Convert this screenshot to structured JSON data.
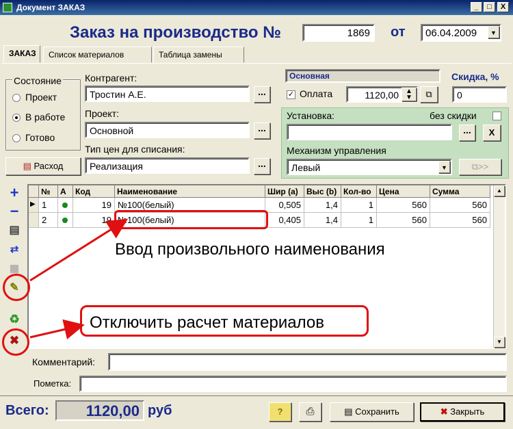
{
  "window": {
    "title": "Документ ЗАКАЗ",
    "buttons": [
      "_",
      "□",
      "X"
    ]
  },
  "header": {
    "title": "Заказ на производство №",
    "number": "1869",
    "date_label": "от",
    "date": "06.04.2009"
  },
  "tabs": [
    {
      "label": "ЗАКАЗ",
      "active": true
    },
    {
      "label": "Список материалов",
      "active": false
    },
    {
      "label": "Таблица замены",
      "active": false
    }
  ],
  "state": {
    "title": "Состояние",
    "options": [
      "Проект",
      "В работе",
      "Готово"
    ],
    "selected": "В работе"
  },
  "contractor": {
    "label": "Контрагент:",
    "value": "Тростин А.Е."
  },
  "project": {
    "label": "Проект:",
    "value": "Основной"
  },
  "price_type": {
    "label": "Тип цен для списания:",
    "value": "Реализация"
  },
  "expense_button": "Расход",
  "account": {
    "label": "Основная"
  },
  "payment": {
    "label": "Оплата",
    "checked": true,
    "value": "1120,00"
  },
  "discount": {
    "label": "Скидка, %",
    "value": "0"
  },
  "installation": {
    "label": "Установка:",
    "value": "",
    "no_discount_label": "без скидки",
    "no_discount_checked": false
  },
  "mechanism": {
    "label": "Механизм управления",
    "value": "Левый"
  },
  "copy_button": ">>",
  "ellipsis": "...",
  "close_x": "X",
  "grid": {
    "columns": [
      "№",
      "А",
      "Код",
      "Наименование",
      "Шир (a)",
      "Выс (b)",
      "Кол-во",
      "Цена",
      "Сумма"
    ],
    "rows": [
      {
        "n": "1",
        "a": "dot",
        "code": "19",
        "name": "№100(белый)",
        "w": "0,505",
        "h": "1,4",
        "qty": "1",
        "price": "560",
        "sum": "560"
      },
      {
        "n": "2",
        "a": "dot",
        "code": "19",
        "name": "№100(белый)",
        "w": "0,405",
        "h": "1,4",
        "qty": "1",
        "price": "560",
        "sum": "560"
      }
    ]
  },
  "annotations": {
    "arbitrary_name": "Ввод произвольного наименования",
    "disable_calc": "Отключить расчет материалов"
  },
  "comment": {
    "label": "Комментарий:",
    "value": ""
  },
  "note": {
    "label": "Пометка:",
    "value": ""
  },
  "footer": {
    "total_label": "Всего:",
    "total_value": "1120,00",
    "currency": "руб",
    "help_label": "?",
    "save_label": "Сохранить",
    "close_label": "Закрыть"
  },
  "colors": {
    "title_blue": "#1a2a8a",
    "annotation_red": "#e01010",
    "green_panel": "#c5e0c0"
  }
}
